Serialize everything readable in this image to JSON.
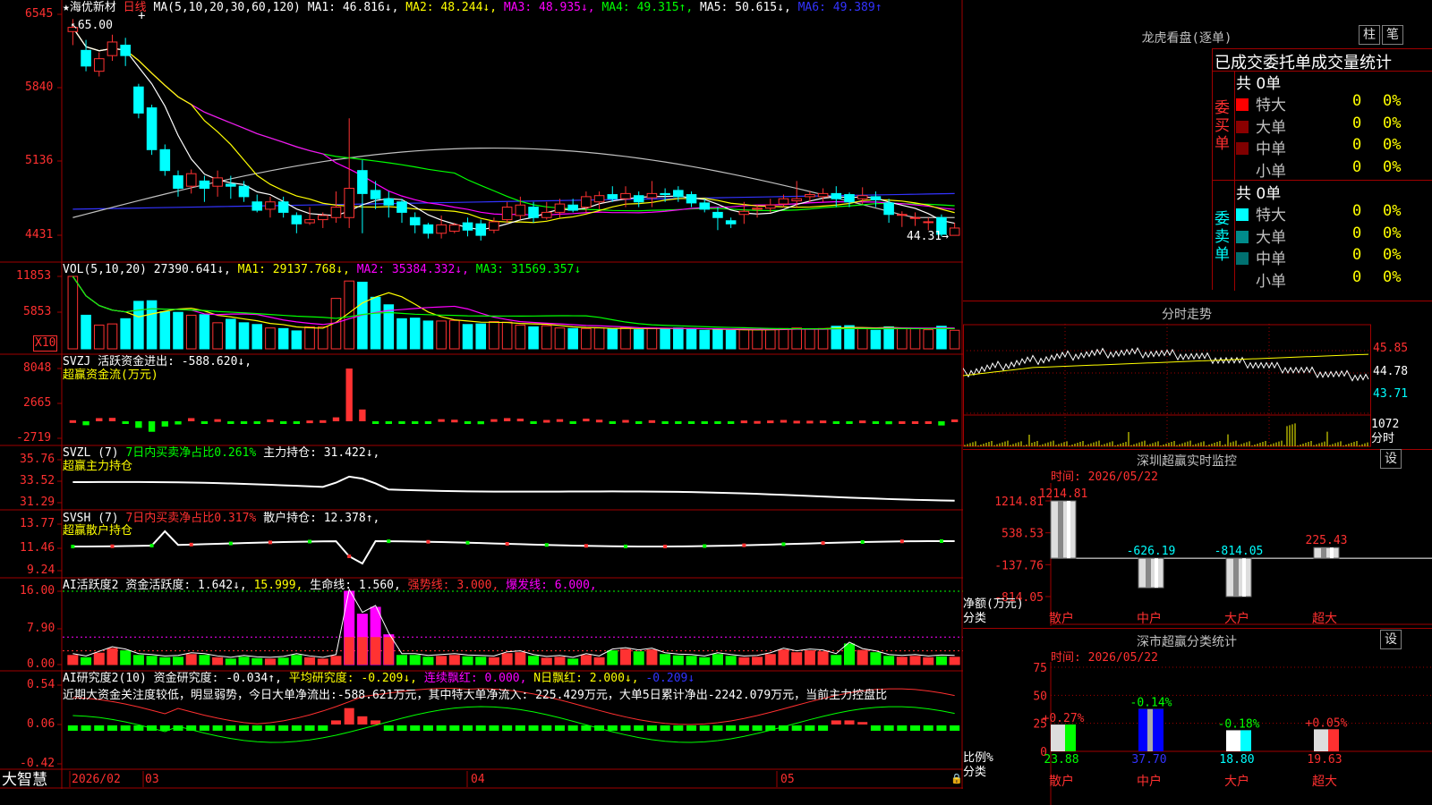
{
  "title": {
    "star": "★",
    "name": "海优新材",
    "period": "日线"
  },
  "colors": {
    "up": "#ff3232",
    "down": "#00ffff",
    "grid": "#a00000",
    "ma1": "#ffffff",
    "ma2": "#ffff00",
    "ma3": "#ff00ff",
    "ma4": "#00ff00",
    "ma5": "#c0c0c0",
    "ma6": "#3333ff"
  },
  "main": {
    "ma_head": "MA(5,10,20,30,60,120)",
    "ma_vals": [
      "MA1: 46.816↓,",
      "MA2: 48.244↓,",
      "MA3: 48.935↓,",
      "MA4: 49.315↑,",
      "MA5: 50.615↓,",
      "MA6: 49.389↑"
    ],
    "y_ticks": [
      "6545",
      "5840",
      "5136",
      "4431"
    ],
    "hi_label": "65.00",
    "lo_label": "44.31→",
    "plus": "+"
  },
  "vol": {
    "head": "VOL(5,10,20)",
    "v1": "27390.641↓,",
    "v2": "MA1: 29137.768↓,",
    "v3": "MA2: 35384.332↓,",
    "v4": "MA3: 31569.357↓",
    "y_ticks": [
      "11853",
      "5853"
    ],
    "unit": "X10"
  },
  "svzj": {
    "head": "SVZJ  活跃资金进出: -588.620↓,",
    "sub": "超赢资金流(万元)",
    "y_ticks": [
      "8048",
      "2665",
      "-2719"
    ]
  },
  "svzl": {
    "head": "SVZL (7)",
    "h2": "7日内买卖净占比0.261%",
    "h3": "主力持仓: 31.422↓,",
    "sub": "超赢主力持仓",
    "y_ticks": [
      "35.76",
      "33.52",
      "31.29"
    ]
  },
  "svsh": {
    "head": "SVSH (7)",
    "h2": "7日内买卖净占比0.317%",
    "h3": "散户持仓: 12.378↑,",
    "sub": "超赢散户持仓",
    "y_ticks": [
      "13.77",
      "11.46",
      "9.24"
    ]
  },
  "ai1": {
    "head": "AI活跃度2",
    "h2": "资金活跃度: 1.642↓,",
    "h3": "15.999,",
    "h4": "生命线: 1.560,",
    "h5": "强势线: 3.000,",
    "h6": "爆发线: 6.000,",
    "y_ticks": [
      "16.00",
      "7.90",
      "0.00"
    ]
  },
  "ai2": {
    "head": "AI研究度2(10)",
    "h2": "资金研究度: -0.034↑,",
    "h3": "平均研究度: -0.209↓,",
    "h4": "连续飘红: 0.000,",
    "h5": "N日飘红: 2.000↓,",
    "h6": "-0.209↓",
    "note": "近期大资金关注度较低，明显弱势，今日大单净流出:-588.621万元，其中特大单净流入: 225.429万元，大单5日累计净出-2242.079万元，当前主力控盘比",
    "y_ticks": [
      "0.54",
      "0.06",
      "-0.42"
    ]
  },
  "xaxis": {
    "brand": "大智慧",
    "labels": [
      "2026/02",
      "03",
      "04",
      "05"
    ]
  },
  "lhb": {
    "title": "龙虎看盘(逐单)",
    "btn1": "柱",
    "btn2": "笔",
    "sub": "已成交委托单成交量统计",
    "buy": {
      "label": "委买单",
      "total": "共 0单",
      "rows": [
        {
          "name": "特大",
          "v": "0",
          "p": "0%",
          "c": "#ff0000"
        },
        {
          "name": "大单",
          "v": "0",
          "p": "0%",
          "c": "#8b0000"
        },
        {
          "name": "中单",
          "v": "0",
          "p": "0%",
          "c": "#800000"
        },
        {
          "name": "小单",
          "v": "0",
          "p": "0%",
          "c": "#000"
        }
      ]
    },
    "sell": {
      "label": "委卖单",
      "total": "共 0单",
      "rows": [
        {
          "name": "特大",
          "v": "0",
          "p": "0%",
          "c": "#00ffff"
        },
        {
          "name": "大单",
          "v": "0",
          "p": "0%",
          "c": "#008b8b"
        },
        {
          "name": "中单",
          "v": "0",
          "p": "0%",
          "c": "#007070"
        },
        {
          "name": "小单",
          "v": "0",
          "p": "0%",
          "c": "#000"
        }
      ]
    }
  },
  "fenshi": {
    "title": "分时走势",
    "y_ticks": [
      "45.85",
      "44.78",
      "43.71"
    ],
    "vol_label": "1072",
    "label2": "分时"
  },
  "monitor": {
    "title": "深圳超赢实时监控",
    "btn": "设",
    "time": "时间: 2026/05/22",
    "y_ticks": [
      "1214.81",
      "538.53",
      "-137.76",
      "-814.05"
    ],
    "unit": "净额(万元)",
    "cat": "分类",
    "bars": [
      {
        "name": "散户",
        "v": 1214.81,
        "label": "1214.81"
      },
      {
        "name": "中户",
        "v": -626.19,
        "label": "-626.19"
      },
      {
        "name": "大户",
        "v": -814.05,
        "label": "-814.05"
      },
      {
        "name": "超大",
        "v": 225.43,
        "label": "225.43"
      }
    ]
  },
  "classify": {
    "title": "深市超赢分类统计",
    "btn": "设",
    "time": "时间: 2026/05/22",
    "y_ticks": [
      "75",
      "50",
      "25",
      "0"
    ],
    "unit": "比例%",
    "cat": "分类",
    "bars": [
      {
        "name": "散户",
        "v": 23.88,
        "chg": "+0.27%",
        "val": "23.88"
      },
      {
        "name": "中户",
        "v": 37.7,
        "chg": "-0.14%",
        "val": "37.70"
      },
      {
        "name": "大户",
        "v": 18.8,
        "chg": "-0.18%",
        "val": "18.80"
      },
      {
        "name": "超大",
        "v": 19.63,
        "chg": "+0.05%",
        "val": "19.63"
      }
    ]
  },
  "chart_data": {
    "type": "candlestick",
    "candles": [
      [
        63.8,
        64.2,
        65.0,
        62.5
      ],
      [
        62.0,
        60.5,
        63.0,
        60.0
      ],
      [
        60.0,
        61.2,
        61.8,
        59.5
      ],
      [
        61.5,
        62.8,
        63.5,
        61.0
      ],
      [
        62.5,
        61.5,
        63.2,
        60.5
      ],
      [
        58.5,
        56.0,
        58.8,
        55.5
      ],
      [
        56.5,
        52.5,
        56.8,
        52.0
      ],
      [
        52.5,
        50.5,
        53.0,
        50.0
      ],
      [
        50.0,
        48.8,
        50.5,
        48.0
      ],
      [
        49.0,
        50.2,
        50.6,
        48.3
      ],
      [
        49.5,
        48.8,
        50.0,
        47.5
      ],
      [
        49.0,
        49.8,
        50.5,
        48.0
      ],
      [
        49.2,
        49.0,
        50.0,
        47.8
      ],
      [
        49.0,
        48.0,
        49.5,
        47.5
      ],
      [
        47.5,
        46.7,
        48.2,
        46.5
      ],
      [
        46.8,
        47.5,
        48.0,
        46.0
      ],
      [
        47.5,
        46.5,
        48.0,
        46.0
      ],
      [
        46.2,
        45.4,
        46.5,
        44.5
      ],
      [
        45.5,
        45.8,
        47.0,
        45.3
      ],
      [
        45.8,
        46.2,
        46.5,
        45.0
      ],
      [
        46.0,
        47.0,
        48.5,
        45.5
      ],
      [
        46.0,
        48.8,
        55.5,
        45.0
      ],
      [
        50.5,
        48.3,
        51.5,
        44.5
      ],
      [
        48.6,
        47.8,
        49.5,
        46.8
      ],
      [
        47.8,
        47.2,
        48.5,
        46.0
      ],
      [
        47.5,
        46.5,
        47.8,
        45.5
      ],
      [
        46.0,
        45.3,
        46.5,
        44.5
      ],
      [
        45.3,
        44.5,
        45.5,
        44.0
      ],
      [
        44.5,
        45.3,
        46.2,
        44.0
      ],
      [
        44.7,
        45.3,
        45.5,
        44.5
      ],
      [
        45.5,
        44.8,
        46.0,
        44.2
      ],
      [
        45.4,
        44.3,
        45.8,
        43.8
      ],
      [
        44.8,
        45.6,
        46.0,
        44.5
      ],
      [
        45.8,
        47.0,
        47.5,
        45.5
      ],
      [
        46.2,
        47.2,
        48.0,
        45.8
      ],
      [
        47.0,
        46.0,
        47.5,
        45.5
      ],
      [
        46.0,
        46.5,
        47.5,
        45.8
      ],
      [
        46.5,
        47.3,
        47.8,
        46.0
      ],
      [
        47.2,
        46.7,
        47.8,
        46.5
      ],
      [
        47.0,
        48.0,
        48.5,
        46.5
      ],
      [
        47.5,
        48.1,
        48.5,
        46.8
      ],
      [
        48.2,
        47.8,
        49.0,
        47.5
      ],
      [
        47.8,
        48.3,
        49.0,
        47.0
      ],
      [
        48.1,
        47.5,
        48.5,
        47.0
      ],
      [
        47.9,
        48.3,
        49.5,
        47.0
      ],
      [
        48.3,
        48.2,
        48.8,
        47.5
      ],
      [
        48.6,
        48.0,
        49.0,
        47.5
      ],
      [
        48.2,
        47.4,
        48.5,
        47.0
      ],
      [
        47.4,
        46.8,
        47.8,
        46.5
      ],
      [
        46.5,
        46.0,
        47.0,
        44.8
      ],
      [
        45.7,
        45.4,
        46.0,
        45.0
      ],
      [
        46.3,
        46.6,
        47.5,
        45.4
      ],
      [
        46.8,
        46.9,
        47.2,
        46.0
      ],
      [
        46.9,
        47.2,
        47.8,
        46.5
      ],
      [
        47.3,
        47.8,
        48.2,
        47.0
      ],
      [
        47.6,
        47.8,
        49.5,
        47.0
      ],
      [
        48.0,
        48.2,
        48.5,
        47.5
      ],
      [
        48.0,
        48.3,
        48.8,
        47.5
      ],
      [
        48.3,
        47.8,
        49.0,
        47.0
      ],
      [
        48.2,
        47.5,
        48.4,
        47.0
      ],
      [
        47.8,
        48.1,
        48.9,
        47.3
      ],
      [
        48.0,
        47.7,
        48.5,
        47.0
      ],
      [
        47.4,
        46.3,
        47.8,
        45.5
      ],
      [
        46.3,
        46.3,
        46.6,
        45.1
      ],
      [
        46.0,
        46.0,
        46.5,
        45.2
      ],
      [
        45.6,
        45.6,
        46.0,
        44.8
      ],
      [
        46.0,
        44.4,
        46.3,
        44.2
      ],
      [
        44.3,
        45.0,
        45.5,
        44.3
      ]
    ],
    "volume": [
      12500,
      5800,
      4100,
      4300,
      5200,
      8200,
      8300,
      6400,
      6300,
      5800,
      5900,
      4500,
      5100,
      4500,
      4200,
      3600,
      3500,
      3100,
      3800,
      3800,
      8700,
      11700,
      11500,
      8900,
      7600,
      5200,
      5300,
      4800,
      4800,
      4900,
      4200,
      4300,
      4700,
      4600,
      4100,
      3800,
      4000,
      3600,
      3500,
      3500,
      3600,
      3400,
      3700,
      3300,
      3600,
      3400,
      3600,
      3500,
      3200,
      3300,
      3200,
      3300,
      3400,
      3300,
      3500,
      3600,
      3400,
      3500,
      3900,
      4000,
      3500,
      3200,
      3800,
      3600,
      3500,
      3300,
      3900,
      3200
    ],
    "y_range": [
      44.31,
      65.45
    ]
  }
}
